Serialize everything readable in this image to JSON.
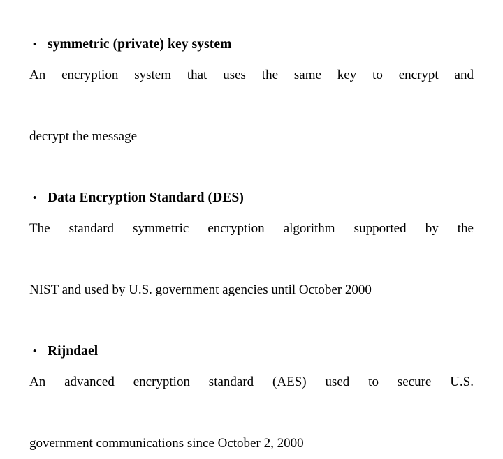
{
  "slide": {
    "background_color": "#ffffff",
    "text_color": "#000000",
    "bullet_glyph": "•",
    "sections": [
      {
        "heading": "symmetric (private) key system",
        "body_full": "An encryption system that uses the same key to encrypt and decrypt the message",
        "body_line_1": "An encryption system that uses the same key to encrypt and",
        "body_line_2": "decrypt the message"
      },
      {
        "heading": "Data Encryption Standard (DES)",
        "body_full": "The standard symmetric encryption algorithm supported by the NIST and used by U.S. government agencies until October 2000",
        "body_line_1": "The standard symmetric encryption algorithm supported by the",
        "body_line_2": "NIST and used by U.S. government agencies until October 2000"
      },
      {
        "heading": "Rijndael",
        "body_full": "An advanced encryption standard (AES) used to secure U.S. government communications since October 2, 2000",
        "body_line_1": "An advanced encryption standard (AES) used to secure U.S.",
        "body_line_2": "government communications since October 2, 2000"
      }
    ]
  }
}
